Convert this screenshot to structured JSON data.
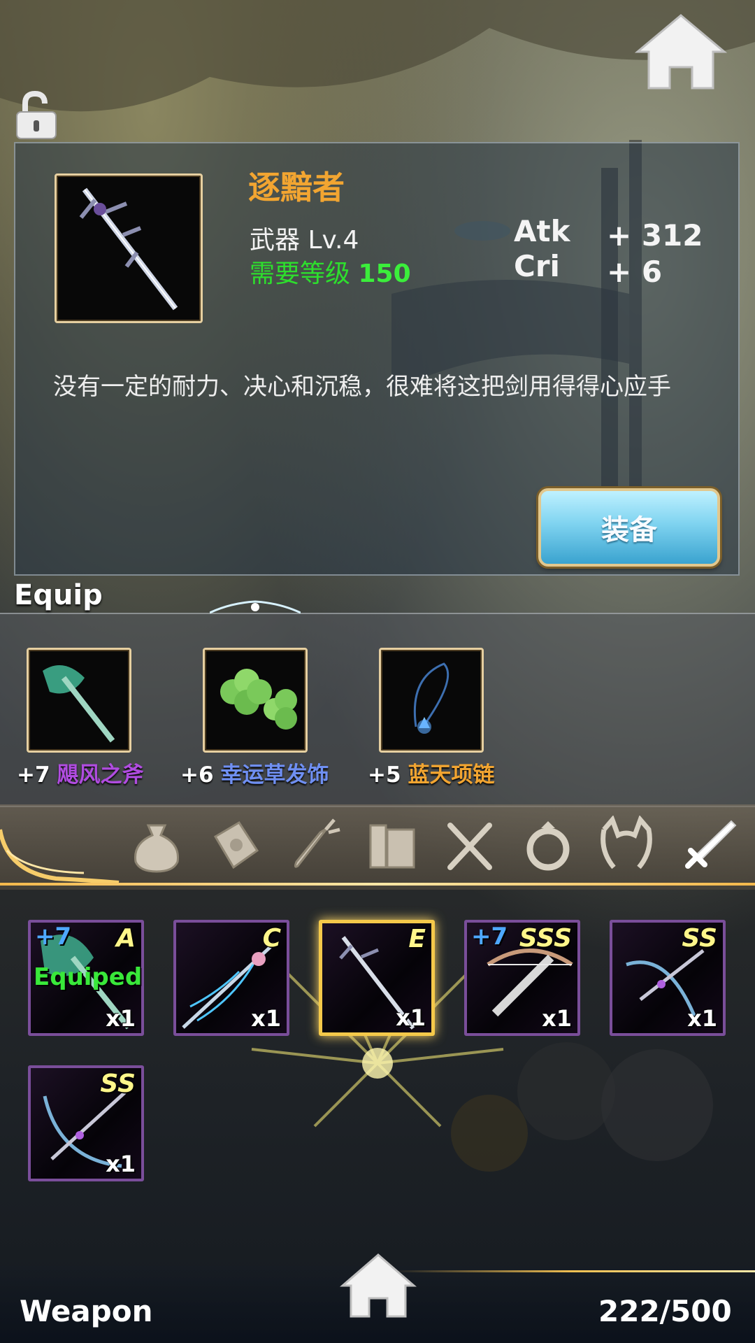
{
  "detail": {
    "name": "逐黯者",
    "type_level": "武器 Lv.4",
    "req_prefix": "需要等级",
    "req_value": "150",
    "stats": [
      {
        "key": "Atk",
        "value": "+ 312"
      },
      {
        "key": "Cri",
        "value": "+ 6"
      }
    ],
    "description": "没有一定的耐力、决心和沉稳，很难将这把剑用得得心应手",
    "equip_button": "装备"
  },
  "equip_section": {
    "title": "Equip",
    "items": [
      {
        "plus": "+7",
        "name": "飓风之斧",
        "color": "#b04ce0"
      },
      {
        "plus": "+6",
        "name": "幸运草发饰",
        "color": "#6f8ff2"
      },
      {
        "plus": "+5",
        "name": "蓝天项链",
        "color": "#f2a531"
      }
    ]
  },
  "tabs": [
    "bag-icon",
    "scroll-icon",
    "carrot-icon",
    "book-icon",
    "utensils-icon",
    "ring-icon",
    "headband-icon",
    "sword-icon"
  ],
  "inventory": [
    {
      "level": "+7",
      "grade": "A",
      "status": "Equiped",
      "count": "x1"
    },
    {
      "level": "",
      "grade": "C",
      "status": "",
      "count": "x1"
    },
    {
      "level": "",
      "grade": "E",
      "status": "",
      "count": "x1"
    },
    {
      "level": "+7",
      "grade": "SSS",
      "status": "",
      "count": "x1"
    },
    {
      "level": "",
      "grade": "SS",
      "status": "",
      "count": "x1"
    },
    {
      "level": "",
      "grade": "SS",
      "status": "",
      "count": "x1"
    }
  ],
  "footer": {
    "category": "Weapon",
    "capacity": "222/500"
  },
  "colors": {
    "accent_gold": "#f2a531",
    "requirement_green": "#2ddf2d",
    "grade_yellow": "#fff68a",
    "slot_purple": "#7a4e9a"
  }
}
